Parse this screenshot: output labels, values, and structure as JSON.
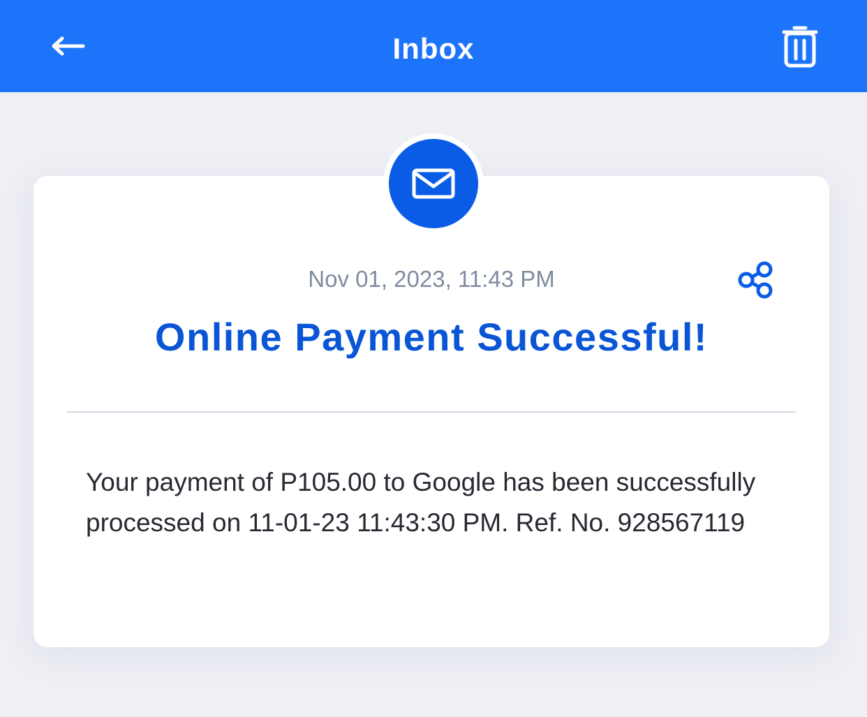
{
  "header": {
    "title": "Inbox",
    "back_icon": "arrow-left-icon",
    "delete_icon": "trash-icon",
    "color": "#1c74fb"
  },
  "message": {
    "icon": "envelope-icon",
    "date": "Nov 01, 2023, 11:43 PM",
    "share_icon": "share-icon",
    "title": "Online Payment Successful!",
    "body": "Your payment of P105.00 to Google has been successfully processed on 11-01-23 11:43:30 PM. Ref. No. 928567119",
    "accent_color": "#0a55d6"
  }
}
